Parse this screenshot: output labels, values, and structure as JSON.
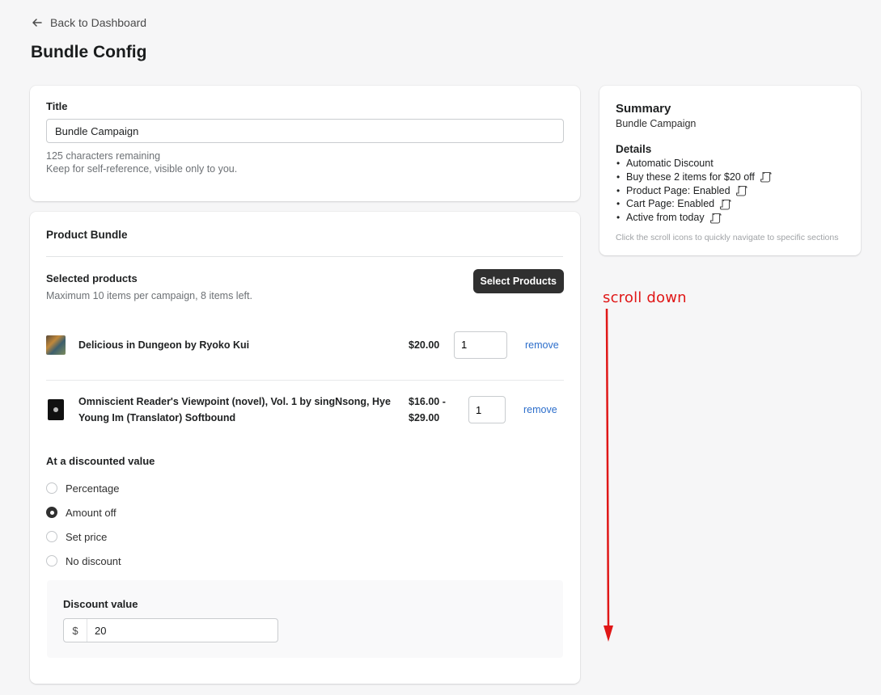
{
  "header": {
    "back_label": "Back to Dashboard",
    "page_title": "Bundle Config"
  },
  "title_card": {
    "label": "Title",
    "value": "Bundle Campaign",
    "remaining": "125 characters remaining",
    "help": "Keep for self-reference, visible only to you."
  },
  "bundle_card": {
    "title": "Product Bundle",
    "selected_label": "Selected products",
    "selected_help": "Maximum 10 items per campaign, 8 items left.",
    "select_button": "Select Products",
    "products": [
      {
        "name": "Delicious in Dungeon by Ryoko Kui",
        "price": "$20.00",
        "qty": "1",
        "remove": "remove"
      },
      {
        "name": "Omniscient Reader's Viewpoint (novel), Vol. 1 by singNsong, Hye Young Im (Translator) Softbound",
        "price": "$16.00 - $29.00",
        "qty": "1",
        "remove": "remove"
      }
    ],
    "discount_title": "At a discounted value",
    "options": [
      "Percentage",
      "Amount off",
      "Set price",
      "No discount"
    ],
    "selected_option": "Amount off",
    "discount_value_label": "Discount value",
    "currency_prefix": "$",
    "discount_value": "20"
  },
  "summary": {
    "title": "Summary",
    "subtitle": "Bundle Campaign",
    "details_title": "Details",
    "items": [
      {
        "text": "Automatic Discount",
        "scroll_icon": false
      },
      {
        "text": "Buy these 2 items for $20 off",
        "scroll_icon": true
      },
      {
        "text": "Product Page: Enabled",
        "scroll_icon": true
      },
      {
        "text": "Cart Page: Enabled",
        "scroll_icon": true
      },
      {
        "text": "Active from today",
        "scroll_icon": true
      }
    ],
    "hint": "Click the scroll icons to quickly navigate to specific sections"
  },
  "annotation": {
    "text": "scroll down",
    "color": "#e01717"
  },
  "colors": {
    "link": "#2c6ecb",
    "primary_button": "#303030",
    "background": "#f6f6f7"
  }
}
